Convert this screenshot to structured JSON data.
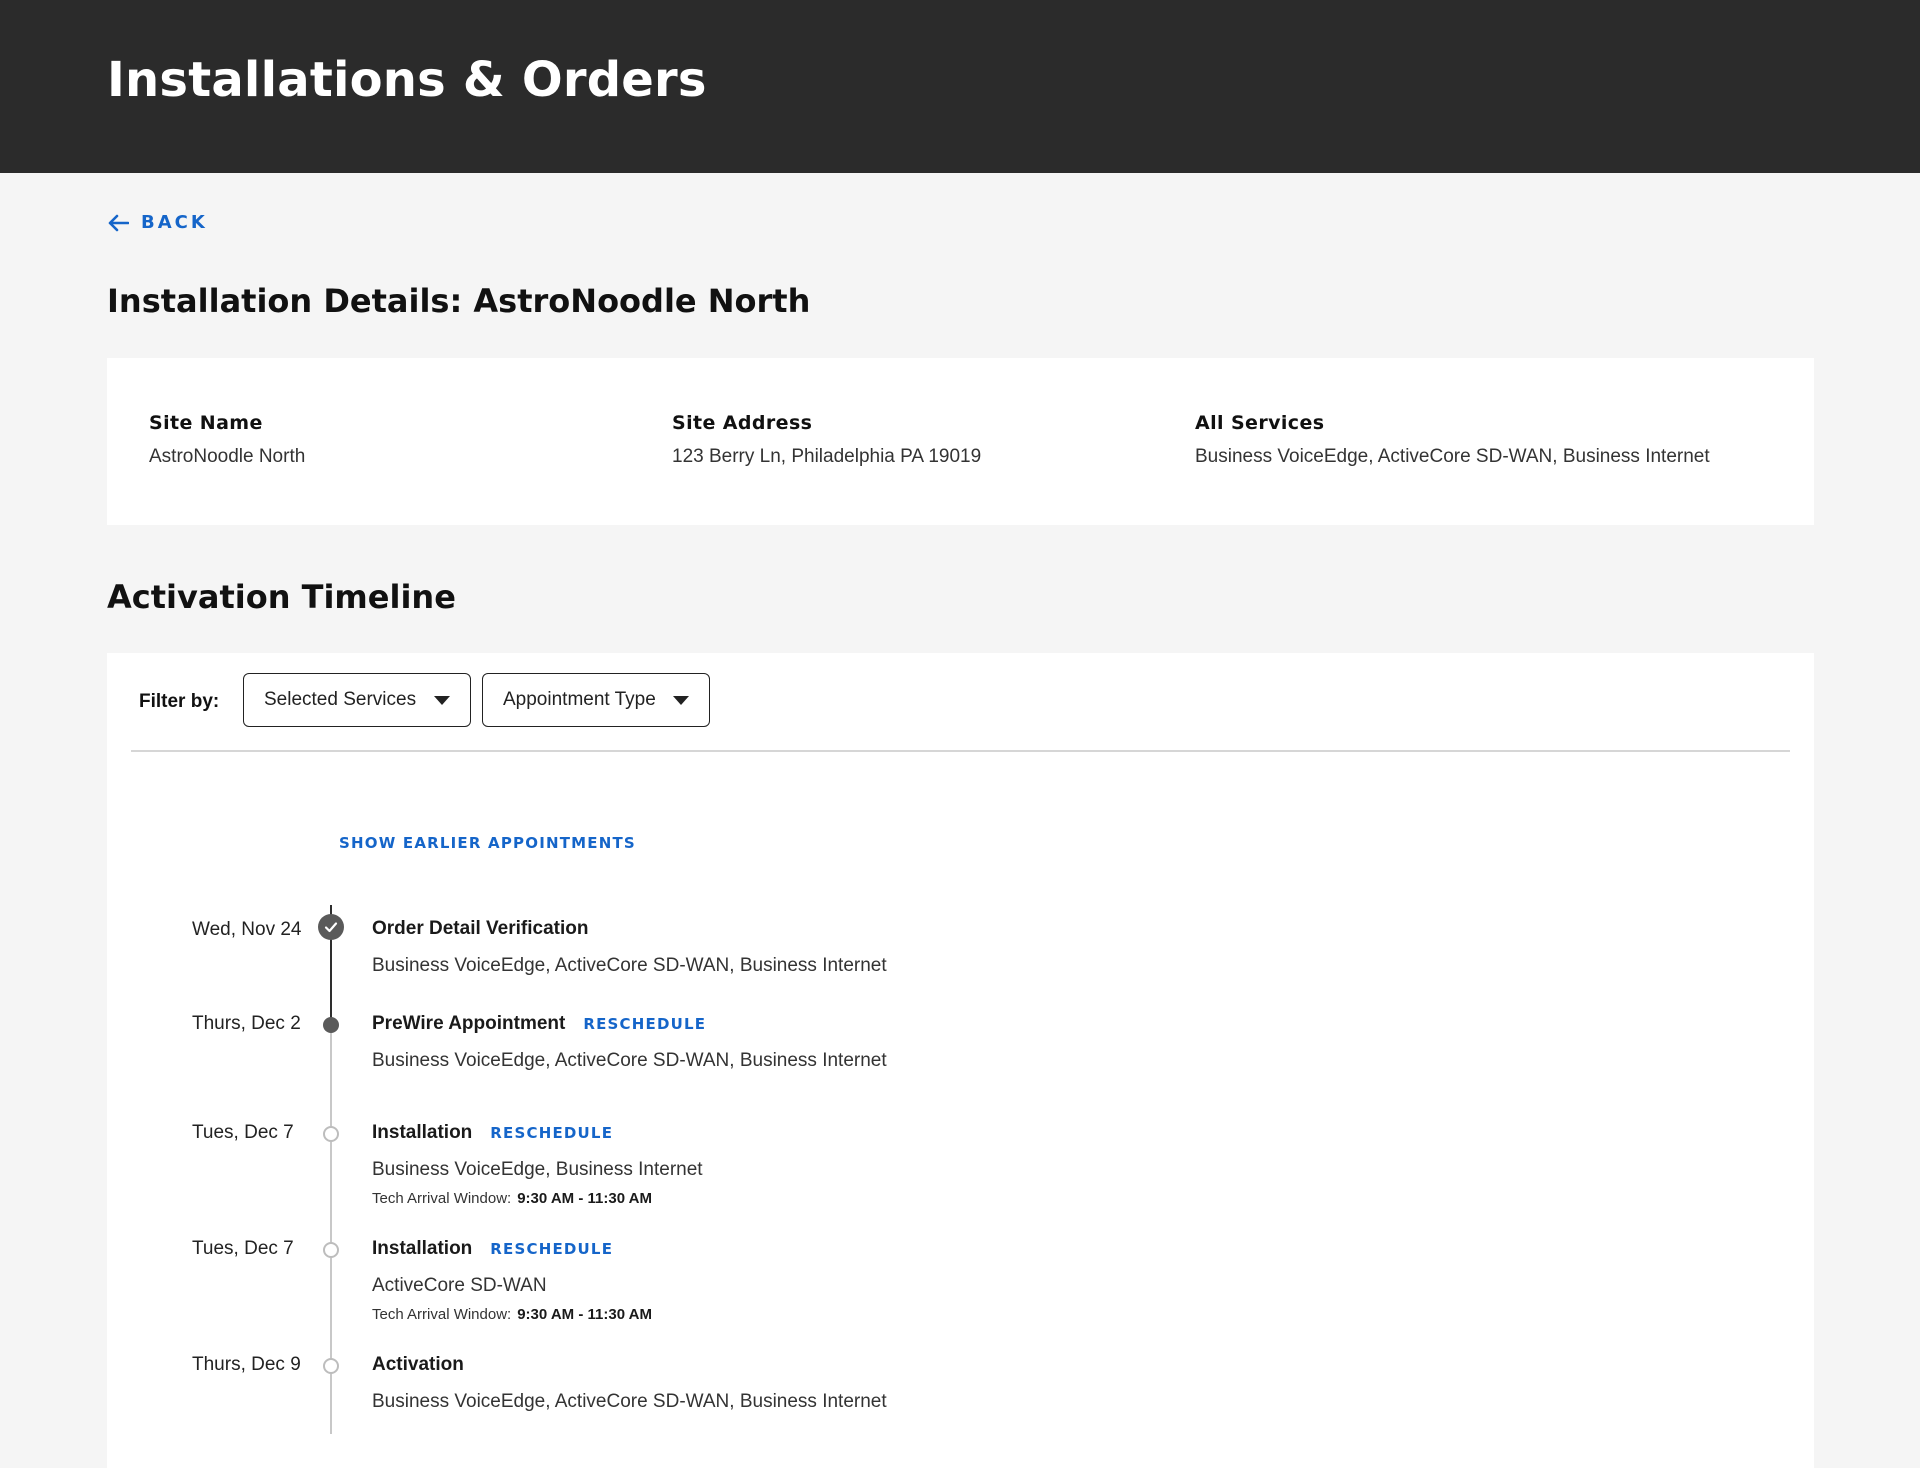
{
  "header": {
    "title": "Installations & Orders"
  },
  "nav": {
    "back_label": "BACK"
  },
  "page": {
    "title": "Installation Details: AstroNoodle North"
  },
  "site": {
    "name_label": "Site Name",
    "name_value": "AstroNoodle North",
    "address_label": "Site Address",
    "address_value": "123 Berry Ln, Philadelphia PA 19019",
    "services_label": "All Services",
    "services_value": "Business VoiceEdge, ActiveCore SD-WAN, Business Internet"
  },
  "timeline": {
    "title": "Activation Timeline",
    "filter_label": "Filter by:",
    "filters": [
      {
        "label": "Selected Services"
      },
      {
        "label": "Appointment Type"
      }
    ],
    "show_earlier": "SHOW EARLIER APPOINTMENTS",
    "reschedule_label": "RESCHEDULE",
    "tech_window_label": "Tech Arrival Window:",
    "events": [
      {
        "date": "Wed, Nov 24",
        "title": "Order Detail Verification",
        "services": "Business VoiceEdge, ActiveCore SD-WAN, Business Internet",
        "status": "completed"
      },
      {
        "date": "Thurs, Dec 2",
        "title": "PreWire Appointment",
        "services": "Business VoiceEdge, ActiveCore SD-WAN, Business Internet",
        "status": "current",
        "reschedule": "RESCHEDULE"
      },
      {
        "date": "Tues, Dec 7",
        "title": "Installation",
        "services": "Business VoiceEdge, Business Internet",
        "status": "upcoming",
        "reschedule": "RESCHEDULE",
        "tech_window": "9:30 AM - 11:30 AM"
      },
      {
        "date": "Tues, Dec 7",
        "title": "Installation",
        "services": "ActiveCore SD-WAN",
        "status": "upcoming",
        "reschedule": "RESCHEDULE",
        "tech_window": "9:30 AM - 11:30 AM"
      },
      {
        "date": "Thurs, Dec 9",
        "title": "Activation",
        "services": "Business VoiceEdge, ActiveCore SD-WAN, Business Internet",
        "status": "upcoming"
      }
    ]
  },
  "colors": {
    "header_bg": "#2b2b2b",
    "page_bg": "#f5f5f5",
    "link": "#1565c9",
    "node_done": "#5a5a5a",
    "node_upcoming": "#bdbdbd"
  }
}
